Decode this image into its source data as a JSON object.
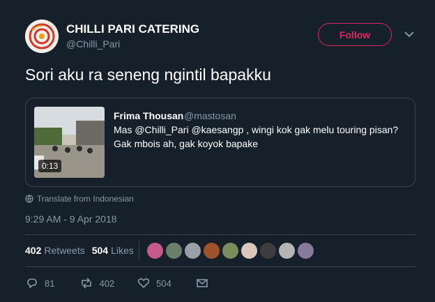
{
  "author": {
    "name": "CHILLI PARI CATERING",
    "handle": "@Chilli_Pari",
    "follow_label": "Follow"
  },
  "tweet": {
    "text": "Sori aku ra seneng ngintil bapakku"
  },
  "quoted": {
    "name": "Frima Thousan",
    "handle": "@mastosan",
    "line1": "Mas @Chilli_Pari @kaesangp , wingi kok gak melu touring pisan?",
    "line2": "Gak mbois ah, gak koyok bapake",
    "video_duration": "0:13"
  },
  "translate_label": "Translate from Indonesian",
  "timestamp": "9:29 AM - 9 Apr 2018",
  "stats": {
    "retweets_count": "402",
    "retweets_label": "Retweets",
    "likes_count": "504",
    "likes_label": "Likes"
  },
  "liker_colors": [
    "#c45a8a",
    "#6b7f6a",
    "#9aa0a6",
    "#a0522d",
    "#7a8c5c",
    "#d9c7b8",
    "#3d3d3d",
    "#b5b5b5",
    "#8a7a9a"
  ],
  "actions": {
    "replies": "81",
    "retweets": "402",
    "likes": "504"
  },
  "colors": {
    "background": "#15202b",
    "follow_accent": "#e0245e",
    "muted": "#8899a6",
    "border": "#38444d"
  }
}
